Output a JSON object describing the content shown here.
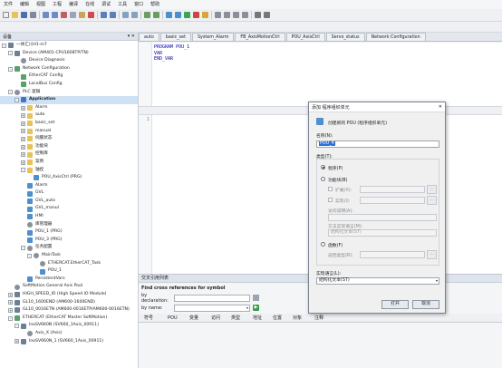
{
  "menu": [
    "文件",
    "编辑",
    "视图",
    "工程",
    "编译",
    "在线",
    "调试",
    "工具",
    "窗口",
    "帮助"
  ],
  "colors": {
    "accent": "#4673c4",
    "selection": "#cfe1f5",
    "keyword": "#0000a8"
  },
  "device_panel": {
    "title": "设备",
    "close_glyph": "▾ ✕",
    "tree": [
      {
        "label": "一体汇川H1-m7",
        "indent": 0,
        "exp": "-",
        "icon": "dev"
      },
      {
        "label": "Device (AM401-CPU1608TP/TN)",
        "indent": 1,
        "exp": "-",
        "icon": "dev"
      },
      {
        "label": "Device Diagnosis",
        "indent": 2,
        "exp": "",
        "icon": "gear"
      },
      {
        "label": "Network Configuration",
        "indent": 1,
        "exp": "-",
        "icon": "net"
      },
      {
        "label": "EtherCAT Config",
        "indent": 2,
        "exp": "",
        "icon": "net"
      },
      {
        "label": "LocalBus Config",
        "indent": 2,
        "exp": "",
        "icon": "net"
      },
      {
        "label": "PLC 逻辑",
        "indent": 1,
        "exp": "-",
        "icon": "gear"
      },
      {
        "label": "Application",
        "indent": 2,
        "exp": "-",
        "icon": "app",
        "selected": true,
        "bold": true
      },
      {
        "label": "Alarm",
        "indent": 3,
        "exp": "+",
        "icon": "folder"
      },
      {
        "label": "auto",
        "indent": 3,
        "exp": "+",
        "icon": "folder"
      },
      {
        "label": "basic_set",
        "indent": 3,
        "exp": "+",
        "icon": "folder"
      },
      {
        "label": "manual",
        "indent": 3,
        "exp": "+",
        "icon": "folder"
      },
      {
        "label": "伺服状态",
        "indent": 3,
        "exp": "+",
        "icon": "folder"
      },
      {
        "label": "功能块",
        "indent": 3,
        "exp": "+",
        "icon": "folder"
      },
      {
        "label": "控制库",
        "indent": 3,
        "exp": "+",
        "icon": "folder"
      },
      {
        "label": "案例",
        "indent": 3,
        "exp": "+",
        "icon": "folder"
      },
      {
        "label": "轴控",
        "indent": 3,
        "exp": "-",
        "icon": "folder"
      },
      {
        "label": "POU_AxisCtrl (PRG)",
        "indent": 4,
        "exp": "",
        "icon": "prg"
      },
      {
        "label": "Alarm",
        "indent": 3,
        "exp": "",
        "icon": "prg"
      },
      {
        "label": "GVL",
        "indent": 3,
        "exp": "",
        "icon": "prg"
      },
      {
        "label": "GVL_auto",
        "indent": 3,
        "exp": "",
        "icon": "prg"
      },
      {
        "label": "GVL_manul",
        "indent": 3,
        "exp": "",
        "icon": "prg"
      },
      {
        "label": "HMI",
        "indent": 3,
        "exp": "",
        "icon": "prg"
      },
      {
        "label": "库管理器",
        "indent": 3,
        "exp": "",
        "icon": "gear"
      },
      {
        "label": "POU_1 (PRG)",
        "indent": 3,
        "exp": "",
        "icon": "prg"
      },
      {
        "label": "POU_3 (PRG)",
        "indent": 3,
        "exp": "",
        "icon": "prg"
      },
      {
        "label": "任务配置",
        "indent": 3,
        "exp": "-",
        "icon": "gear"
      },
      {
        "label": "MainTask",
        "indent": 4,
        "exp": "-",
        "icon": "gear"
      },
      {
        "label": "ETHERCAT.EtherCAT_Task",
        "indent": 5,
        "exp": "",
        "icon": "gear"
      },
      {
        "label": "POU_1",
        "indent": 5,
        "exp": "",
        "icon": "prg"
      },
      {
        "label": "PersistentVars",
        "indent": 3,
        "exp": "",
        "icon": "prg"
      },
      {
        "label": "SoftMotion General Axis Pool",
        "indent": 1,
        "exp": "",
        "icon": "gear"
      },
      {
        "label": "HIGH_SPEED_IO (High Speed IO Module)",
        "indent": 1,
        "exp": "+",
        "icon": "dev"
      },
      {
        "label": "GL10_1600END (AM600-1600END)",
        "indent": 1,
        "exp": "+",
        "icon": "dev"
      },
      {
        "label": "GL10_0016ETN (AM600-0016ETP/AM600-0016ETN)",
        "indent": 1,
        "exp": "+",
        "icon": "dev"
      },
      {
        "label": "ETHERCAT (EtherCAT Master SoftMotion)",
        "indent": 1,
        "exp": "-",
        "icon": "net"
      },
      {
        "label": "InoSV660N (SV660_1Axis_00911)",
        "indent": 2,
        "exp": "-",
        "icon": "dev"
      },
      {
        "label": "Axis_X (Axis)",
        "indent": 3,
        "exp": "",
        "icon": "gear"
      },
      {
        "label": "InoSV660N_1 (SV660_1Axis_00911)",
        "indent": 2,
        "exp": "+",
        "icon": "dev"
      }
    ]
  },
  "tabs": [
    {
      "label": "auto",
      "active": false
    },
    {
      "label": "basic_set",
      "active": false
    },
    {
      "label": "System_Alarm",
      "active": false
    },
    {
      "label": "FB_AxisMotionCtrl",
      "active": false
    },
    {
      "label": "POU_AxisCtrl",
      "active": false
    },
    {
      "label": "Servo_status",
      "active": false
    },
    {
      "label": "Network Configuration",
      "active": false
    }
  ],
  "declaration": {
    "lines": [
      "PROGRAM POU_1",
      "VAR",
      "END_VAR"
    ]
  },
  "implementation": {
    "line_number": "1"
  },
  "xref": {
    "title": "交叉引用列表",
    "find_label": "Find cross references for symbol",
    "by_declaration": "by declaration:",
    "by_name": "by name:",
    "columns": [
      "符号",
      "POU",
      "变量",
      "访问",
      "类型",
      "地址",
      "位置",
      "对象",
      "注释"
    ]
  },
  "dialog": {
    "title": "添加 程序组织单元",
    "close": "✕",
    "subtitle": "创建新的 POU (程序组织单元)",
    "name_label": "名称(N):",
    "name_value": "POU_4",
    "type_label": "类型(T):",
    "type_program": "程序(P)",
    "type_fb": "功能块(B)",
    "extends_label": "扩展(X):",
    "implements_label": "实现(I):",
    "access_label": "访问说明(A):",
    "method_lang_label": "方法实现语言(M):",
    "method_lang_value": "结构化文本(ST)",
    "type_function": "函数(F)",
    "return_type_label": "返回类型(R):",
    "impl_lang_label": "实现语言(L):",
    "impl_lang_value": "结构化文本(ST)",
    "open_button": "打开",
    "cancel_button": "取消",
    "browse_glyph": "...",
    "program_selected": true
  }
}
